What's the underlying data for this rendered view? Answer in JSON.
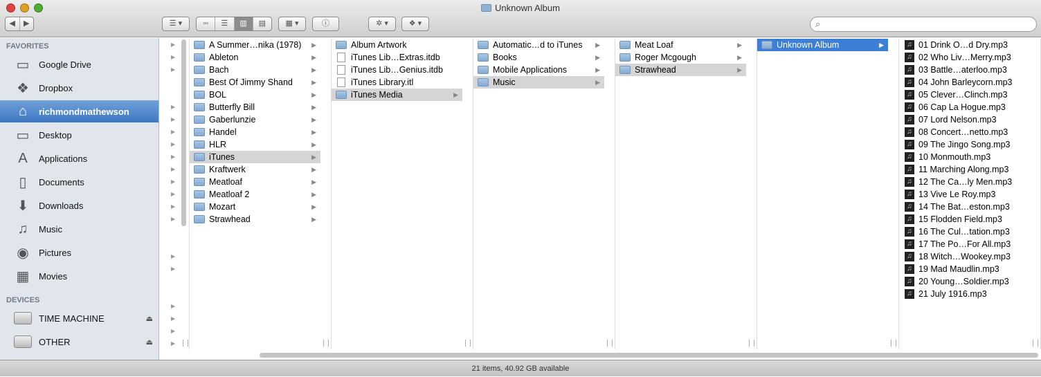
{
  "window": {
    "title": "Unknown Album"
  },
  "toolbar": {
    "back": "◀",
    "forward": "▶",
    "arrange": "☰ ▾",
    "view_icons": "▫▫",
    "view_list": "☰",
    "view_columns": "▥",
    "view_coverflow": "▤",
    "group": "▦ ▾",
    "info": "ⓘ",
    "action": "✲ ▾",
    "dropbox": "❖ ▾",
    "search_placeholder": ""
  },
  "sidebar": {
    "favorites_header": "FAVORITES",
    "favorites": [
      {
        "label": "Google Drive",
        "icon": "folder-icon",
        "glyph": "▭"
      },
      {
        "label": "Dropbox",
        "icon": "dropbox-icon",
        "glyph": "❖"
      },
      {
        "label": "richmondmathewson",
        "icon": "home-icon",
        "glyph": "⌂",
        "selected": true
      },
      {
        "label": "Desktop",
        "icon": "desktop-icon",
        "glyph": "▭"
      },
      {
        "label": "Applications",
        "icon": "applications-icon",
        "glyph": "A"
      },
      {
        "label": "Documents",
        "icon": "documents-icon",
        "glyph": "▯"
      },
      {
        "label": "Downloads",
        "icon": "downloads-icon",
        "glyph": "⬇"
      },
      {
        "label": "Music",
        "icon": "music-icon",
        "glyph": "♫"
      },
      {
        "label": "Pictures",
        "icon": "pictures-icon",
        "glyph": "◉"
      },
      {
        "label": "Movies",
        "icon": "movies-icon",
        "glyph": "▦"
      }
    ],
    "devices_header": "DEVICES",
    "devices": [
      {
        "label": "TIME MACHINE",
        "eject": "⏏"
      },
      {
        "label": "OTHER",
        "eject": "⏏"
      }
    ]
  },
  "columns": [
    {
      "items": [
        {
          "name": "A Summer…nika (1978)",
          "dir": true
        },
        {
          "name": "Ableton",
          "dir": true
        },
        {
          "name": "Bach",
          "dir": true
        },
        {
          "name": "Best Of Jimmy Shand",
          "dir": true
        },
        {
          "name": "BOL",
          "dir": true
        },
        {
          "name": "Butterfly Bill",
          "dir": true
        },
        {
          "name": "Gaberlunzie",
          "dir": true
        },
        {
          "name": "Handel",
          "dir": true
        },
        {
          "name": "HLR",
          "dir": true
        },
        {
          "name": "iTunes",
          "dir": true,
          "state": "sel"
        },
        {
          "name": "Kraftwerk",
          "dir": true
        },
        {
          "name": "Meatloaf",
          "dir": true
        },
        {
          "name": "Meatloaf 2",
          "dir": true
        },
        {
          "name": "Mozart",
          "dir": true
        },
        {
          "name": "Strawhead",
          "dir": true
        }
      ]
    },
    {
      "items": [
        {
          "name": "Album Artwork",
          "dir": true,
          "noarrow": true
        },
        {
          "name": "iTunes Lib…Extras.itdb",
          "type": "doc"
        },
        {
          "name": "iTunes Lib…Genius.itdb",
          "type": "doc"
        },
        {
          "name": "iTunes Library.itl",
          "type": "doc"
        },
        {
          "name": "iTunes Media",
          "dir": true,
          "state": "sel"
        }
      ]
    },
    {
      "items": [
        {
          "name": "Automatic…d to iTunes",
          "dir": true
        },
        {
          "name": "Books",
          "dir": true
        },
        {
          "name": "Mobile Applications",
          "dir": true
        },
        {
          "name": "Music",
          "dir": true,
          "state": "sel"
        }
      ]
    },
    {
      "items": [
        {
          "name": "Meat Loaf",
          "dir": true
        },
        {
          "name": "Roger Mcgough",
          "dir": true
        },
        {
          "name": "Strawhead",
          "dir": true,
          "state": "sel"
        }
      ]
    },
    {
      "items": [
        {
          "name": "Unknown Album",
          "dir": true,
          "state": "hl"
        }
      ]
    },
    {
      "items": [
        {
          "name": "01 Drink O…d Dry.mp3",
          "type": "mp3"
        },
        {
          "name": "02 Who Liv…Merry.mp3",
          "type": "mp3"
        },
        {
          "name": "03 Battle…aterloo.mp3",
          "type": "mp3"
        },
        {
          "name": "04 John Barleycorn.mp3",
          "type": "mp3"
        },
        {
          "name": "05 Clever…Clinch.mp3",
          "type": "mp3"
        },
        {
          "name": "06 Cap La Hogue.mp3",
          "type": "mp3"
        },
        {
          "name": "07 Lord Nelson.mp3",
          "type": "mp3"
        },
        {
          "name": "08 Concert…netto.mp3",
          "type": "mp3"
        },
        {
          "name": "09 The Jingo Song.mp3",
          "type": "mp3"
        },
        {
          "name": "10 Monmouth.mp3",
          "type": "mp3"
        },
        {
          "name": "11 Marching Along.mp3",
          "type": "mp3"
        },
        {
          "name": "12 The Ca…ly Men.mp3",
          "type": "mp3"
        },
        {
          "name": "13 Vive Le Roy.mp3",
          "type": "mp3"
        },
        {
          "name": "14 The Bat…eston.mp3",
          "type": "mp3"
        },
        {
          "name": "15 Flodden Field.mp3",
          "type": "mp3"
        },
        {
          "name": "16 The Cul…tation.mp3",
          "type": "mp3"
        },
        {
          "name": "17 The Po…For All.mp3",
          "type": "mp3"
        },
        {
          "name": "18 Witch…Wookey.mp3",
          "type": "mp3"
        },
        {
          "name": "19 Mad Maudlin.mp3",
          "type": "mp3"
        },
        {
          "name": "20 Young…Soldier.mp3",
          "type": "mp3"
        },
        {
          "name": "21 July 1916.mp3",
          "type": "mp3"
        }
      ]
    }
  ],
  "status": "21 items, 40.92 GB available"
}
